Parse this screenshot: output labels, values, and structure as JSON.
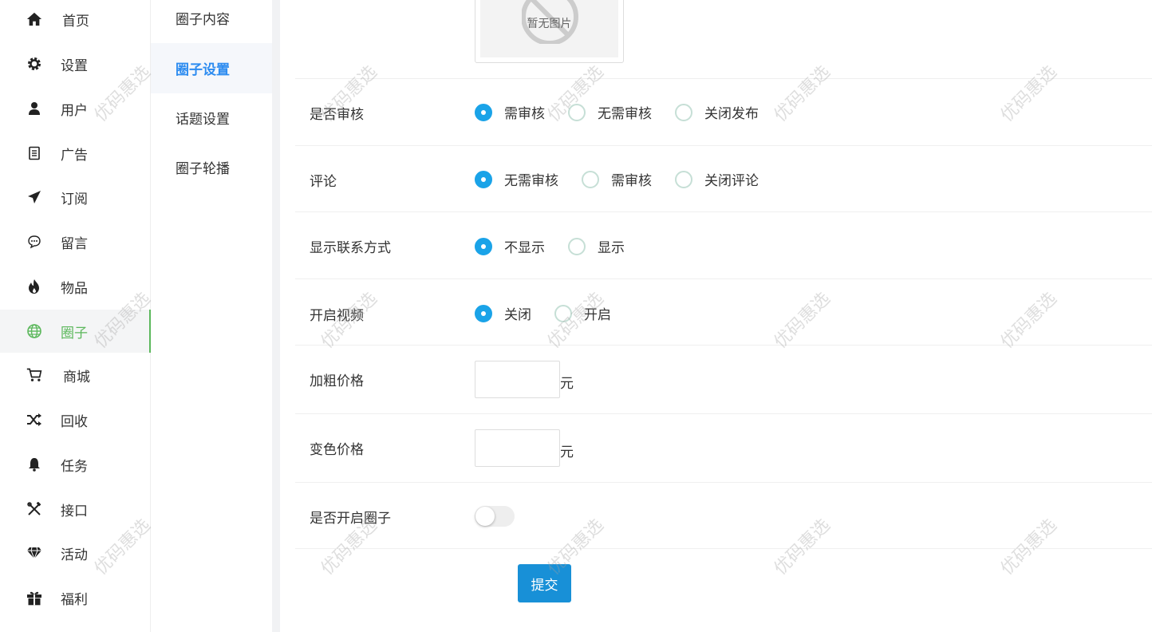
{
  "sidebar": {
    "items": [
      {
        "label": "首页",
        "icon": "home-icon"
      },
      {
        "label": "设置",
        "icon": "gear-icon"
      },
      {
        "label": "用户",
        "icon": "user-icon"
      },
      {
        "label": "广告",
        "icon": "document-icon"
      },
      {
        "label": "订阅",
        "icon": "paper-plane-icon"
      },
      {
        "label": "留言",
        "icon": "chat-bubble-icon"
      },
      {
        "label": "物品",
        "icon": "fire-icon"
      },
      {
        "label": "圈子",
        "icon": "globe-icon",
        "active": true
      },
      {
        "label": "商城",
        "icon": "cart-icon"
      },
      {
        "label": "回收",
        "icon": "shuffle-icon"
      },
      {
        "label": "任务",
        "icon": "bell-icon"
      },
      {
        "label": "接口",
        "icon": "tools-icon"
      },
      {
        "label": "活动",
        "icon": "diamond-icon"
      },
      {
        "label": "福利",
        "icon": "gift-icon"
      }
    ],
    "active_color": "#5cb85c"
  },
  "submenu": {
    "items": [
      {
        "label": "圈子内容"
      },
      {
        "label": "圈子设置",
        "active": true
      },
      {
        "label": "话题设置"
      },
      {
        "label": "圈子轮播"
      }
    ],
    "active_color": "#2d8cf0"
  },
  "form": {
    "image_placeholder": "暂无图片",
    "audit": {
      "label": "是否审核",
      "options": [
        "需审核",
        "无需审核",
        "关闭发布"
      ],
      "selected": "需审核"
    },
    "comment": {
      "label": "评论",
      "options": [
        "无需审核",
        "需审核",
        "关闭评论"
      ],
      "selected": "无需审核"
    },
    "contact": {
      "label": "显示联系方式",
      "options": [
        "不显示",
        "显示"
      ],
      "selected": "不显示"
    },
    "video": {
      "label": "开启视频",
      "options": [
        "关闭",
        "开启"
      ],
      "selected": "关闭"
    },
    "bold_price": {
      "label": "加粗价格",
      "value": "",
      "unit": "元"
    },
    "color_price": {
      "label": "变色价格",
      "value": "",
      "unit": "元"
    },
    "enable_circle": {
      "label": "是否开启圈子",
      "on": false
    },
    "submit_label": "提交",
    "radio_color": "#1aa3e8",
    "button_color": "#1890d7"
  },
  "watermark": "优码惠选"
}
